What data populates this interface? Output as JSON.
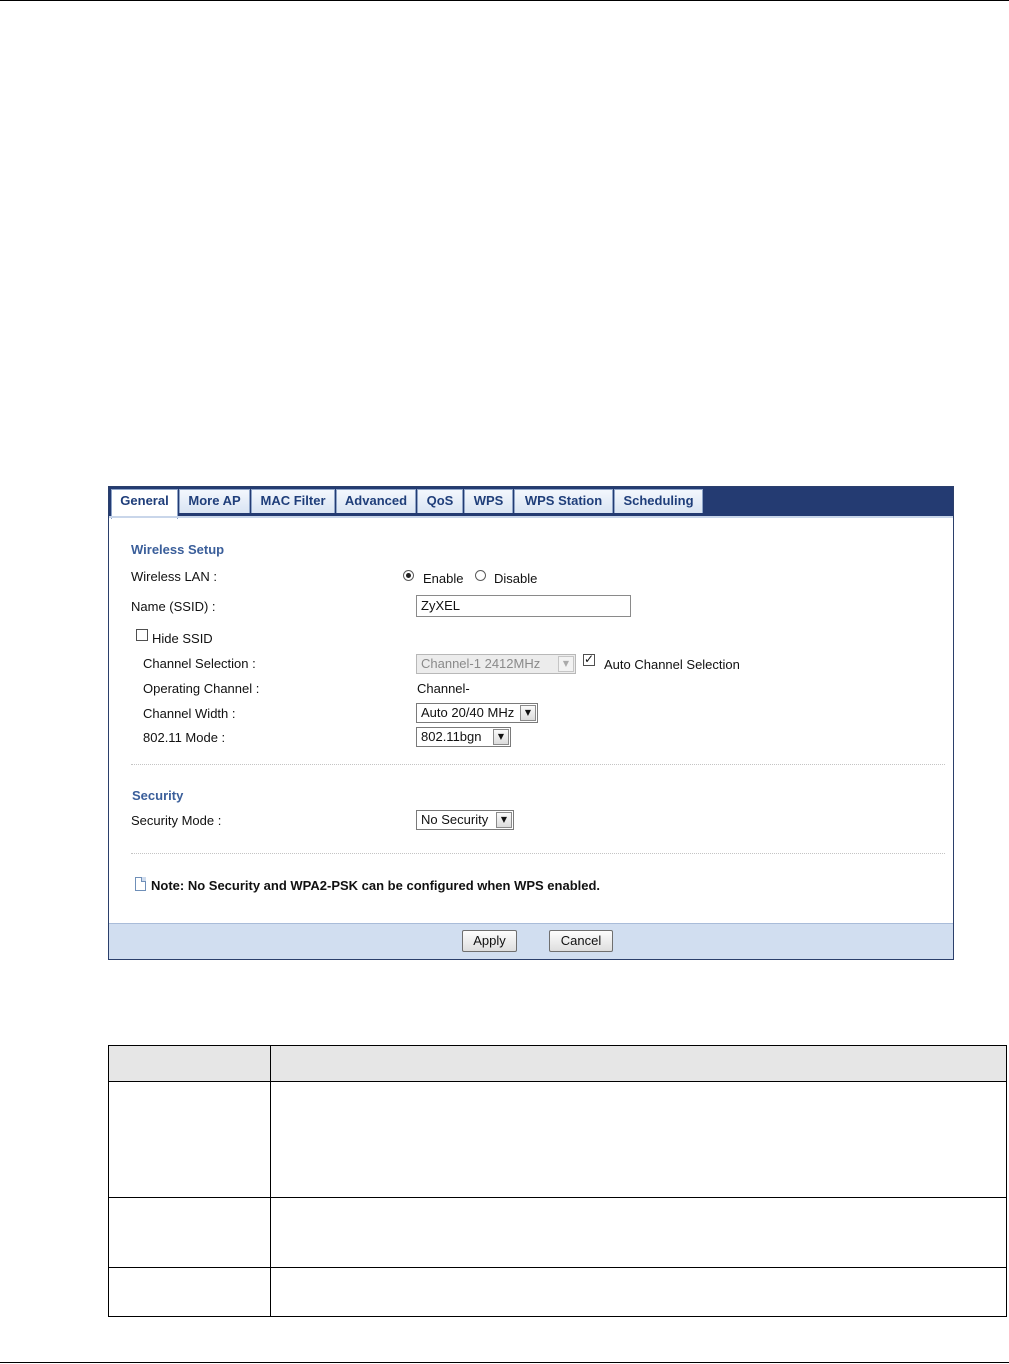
{
  "tabs": [
    {
      "label": "General"
    },
    {
      "label": "More AP"
    },
    {
      "label": "MAC Filter"
    },
    {
      "label": "Advanced"
    },
    {
      "label": "QoS"
    },
    {
      "label": "WPS"
    },
    {
      "label": "WPS Station"
    },
    {
      "label": "Scheduling"
    }
  ],
  "wireless_setup": {
    "title": "Wireless Setup",
    "wireless_lan_label": "Wireless LAN :",
    "enable_label": "Enable",
    "disable_label": "Disable",
    "ssid_label": "Name (SSID) :",
    "ssid_value": "ZyXEL",
    "hide_ssid_label": "Hide SSID",
    "channel_selection_label": "Channel Selection :",
    "channel_selection_value": "Channel-1 2412MHz",
    "auto_channel_label": "Auto Channel Selection",
    "operating_channel_label": "Operating Channel :",
    "operating_channel_value": "Channel-",
    "channel_width_label": "Channel Width :",
    "channel_width_value": "Auto 20/40 MHz",
    "mode_label": "802.11 Mode :",
    "mode_value": "802.11bgn"
  },
  "security": {
    "title": "Security",
    "mode_label": "Security Mode :",
    "mode_value": "No Security"
  },
  "note": "Note: No Security and WPA2-PSK can be configured when WPS enabled.",
  "buttons": {
    "apply": "Apply",
    "cancel": "Cancel"
  }
}
